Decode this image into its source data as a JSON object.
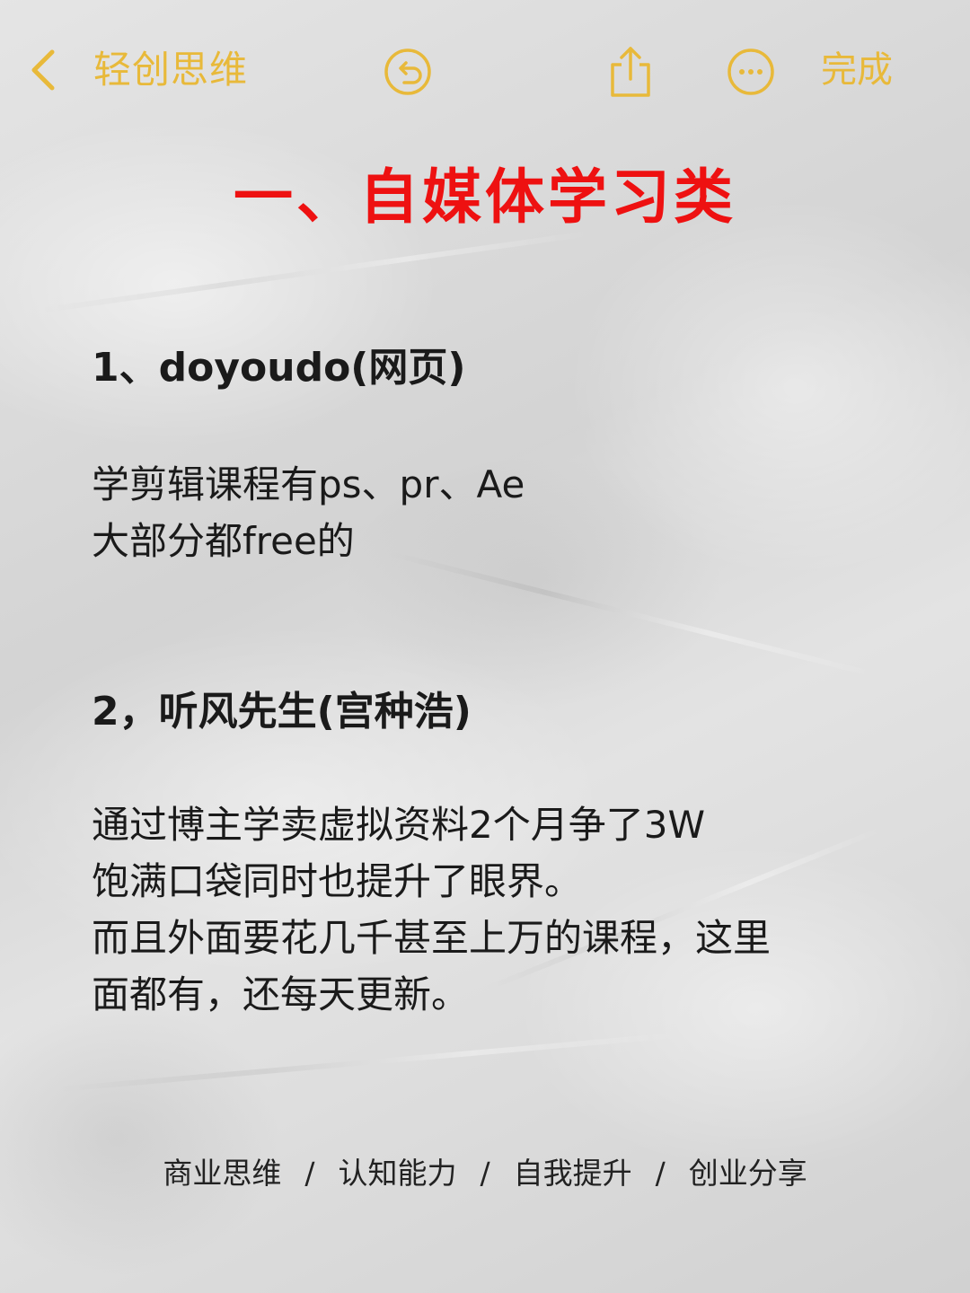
{
  "topbar": {
    "back_icon": "chevron-left-icon",
    "title": "轻创思维",
    "undo_icon": "undo-circle-icon",
    "share_icon": "share-icon",
    "more_icon": "more-circle-icon",
    "done_label": "完成",
    "accent_color": "#e8b93a"
  },
  "headline": {
    "text": "一、自媒体学习类",
    "color": "#ee1111"
  },
  "items": [
    {
      "title": "1、doyoudo(网页)",
      "lines": [
        "学剪辑课程有ps、pr、Ae",
        "大部分都free的"
      ]
    },
    {
      "title": "2，听风先生(宫种浩)",
      "lines": [
        "通过博主学卖虚拟资料2个月争了3W",
        "饱满口袋同时也提升了眼界。",
        "而且外面要花几千甚至上万的课程，这里",
        "面都有，还每天更新。"
      ]
    }
  ],
  "footer": {
    "tags": [
      "商业思维",
      "认知能力",
      "自我提升",
      "创业分享"
    ],
    "separator": "/"
  }
}
